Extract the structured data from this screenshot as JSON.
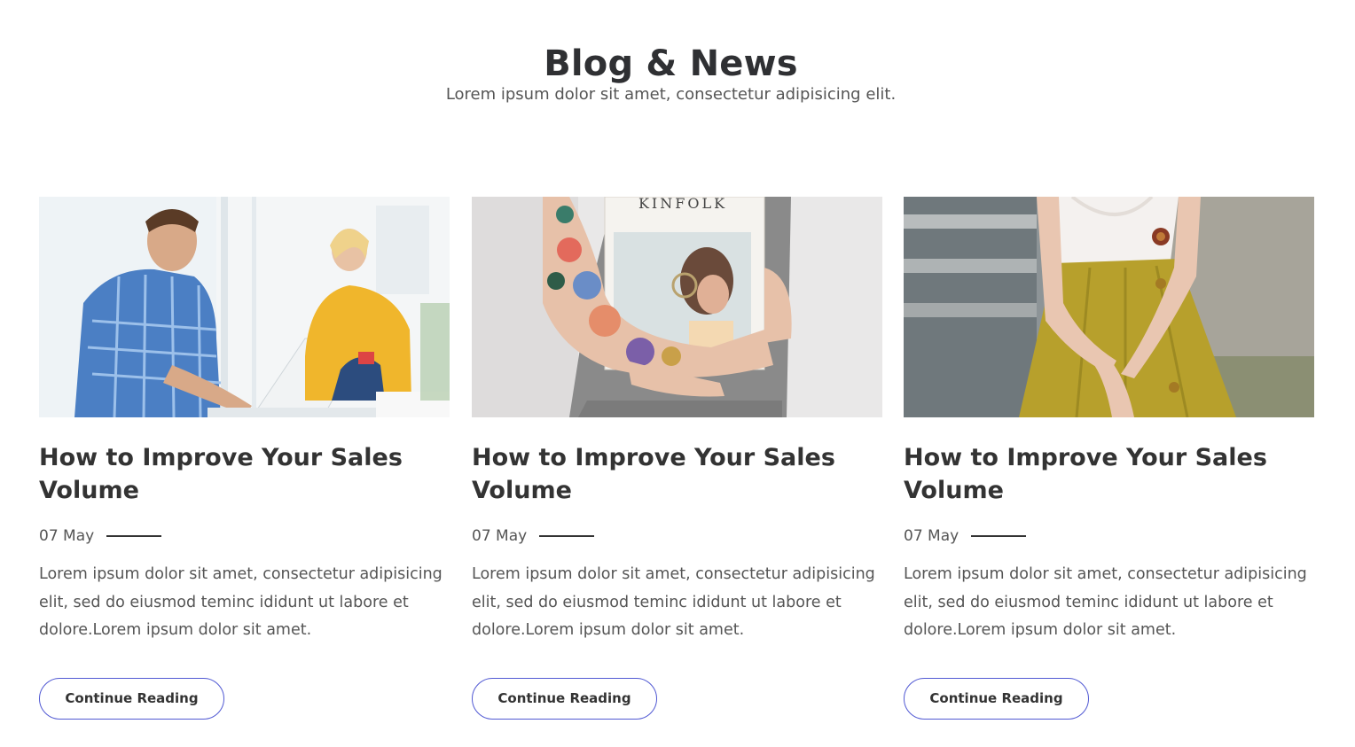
{
  "header": {
    "title": "Blog & News",
    "subtitle": "Lorem ipsum dolor sit amet, consectetur adipisicing elit."
  },
  "posts": [
    {
      "image": "people-working-laptop-photo",
      "title": "How to Improve Your Sales Volume",
      "date": "07 May",
      "excerpt": "Lorem ipsum dolor sit amet, consectetur adipisicing elit, sed do eiusmod teminc ididunt ut labore et dolore.Lorem ipsum dolor sit amet.",
      "button_label": "Continue Reading"
    },
    {
      "image": "tattooed-arm-holding-magazine-photo",
      "image_text": "KINFOLK",
      "title": "How to Improve Your Sales Volume",
      "date": "07 May",
      "excerpt": "Lorem ipsum dolor sit amet, consectetur adipisicing elit, sed do eiusmod teminc ididunt ut labore et dolore.Lorem ipsum dolor sit amet.",
      "button_label": "Continue Reading"
    },
    {
      "image": "woman-yellow-skirt-photo",
      "title": "How to Improve Your Sales Volume",
      "date": "07 May",
      "excerpt": "Lorem ipsum dolor sit amet, consectetur adipisicing elit, sed do eiusmod teminc ididunt ut labore et dolore.Lorem ipsum dolor sit amet.",
      "button_label": "Continue Reading"
    }
  ],
  "colors": {
    "accent": "#5159d3",
    "heading": "#2f3033",
    "text": "#555555"
  }
}
